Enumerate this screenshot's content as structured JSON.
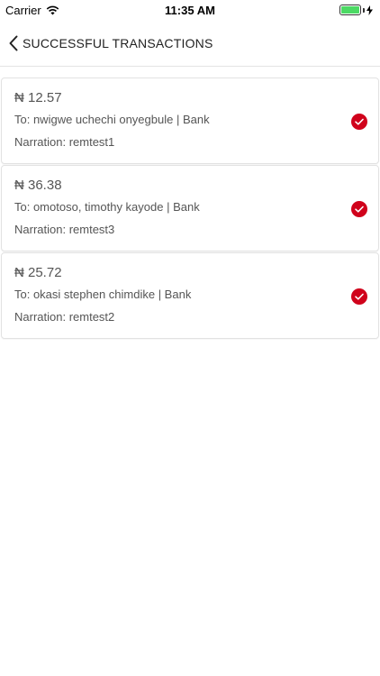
{
  "status_bar": {
    "carrier": "Carrier",
    "time": "11:35 AM",
    "battery_color": "#4cd964"
  },
  "navbar": {
    "title": "SUCCESSFUL TRANSACTIONS"
  },
  "accent_color": "#d0021b",
  "transactions": [
    {
      "amount": "₦ 12.57",
      "recipient": "To: nwigwe uchechi onyegbule | Bank",
      "narration": "Narration: remtest1"
    },
    {
      "amount": "₦ 36.38",
      "recipient": "To: omotoso, timothy kayode | Bank",
      "narration": "Narration: remtest3"
    },
    {
      "amount": "₦ 25.72",
      "recipient": "To: okasi stephen chimdike | Bank",
      "narration": "Narration: remtest2"
    }
  ]
}
